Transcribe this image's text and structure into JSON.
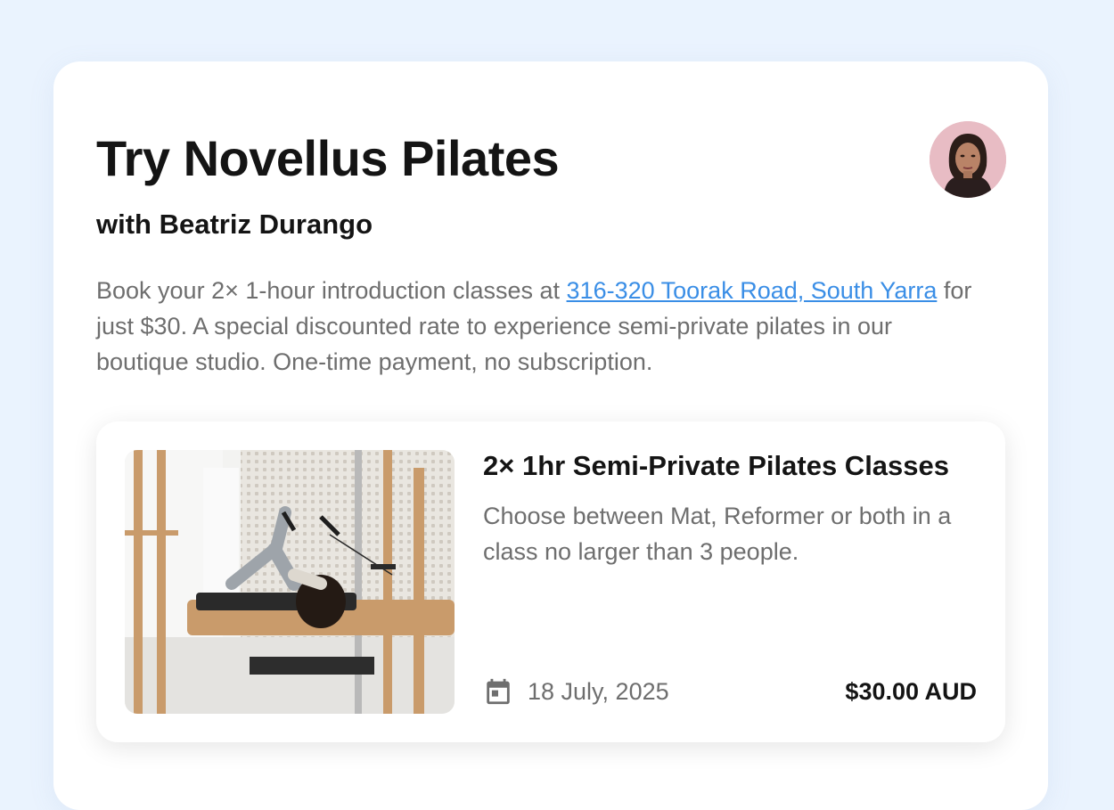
{
  "page": {
    "title": "Try Novellus Pilates",
    "subtitle": "with Beatriz Durango",
    "avatar_icon": "instructor-avatar",
    "description": {
      "before": "Book your 2× 1-hour introduction classes at ",
      "link": "316-320 Toorak Road, South Yarra",
      "after": " for just $30. A special discounted rate to experience semi-private pilates in our boutique studio. One-time payment, no subscription."
    }
  },
  "product": {
    "image_icon": "pilates-reformer-photo",
    "title": "2× 1hr Semi-Private Pilates Classes",
    "description": "Choose between Mat, Reformer or both in a class no larger than 3 people.",
    "date_icon": "calendar-icon",
    "date": "18 July, 2025",
    "price": "$30.00 AUD"
  },
  "colors": {
    "background": "#EAF3FE",
    "link": "#3A8EE6",
    "text_primary": "#141414",
    "text_secondary": "#6E6E6E"
  }
}
